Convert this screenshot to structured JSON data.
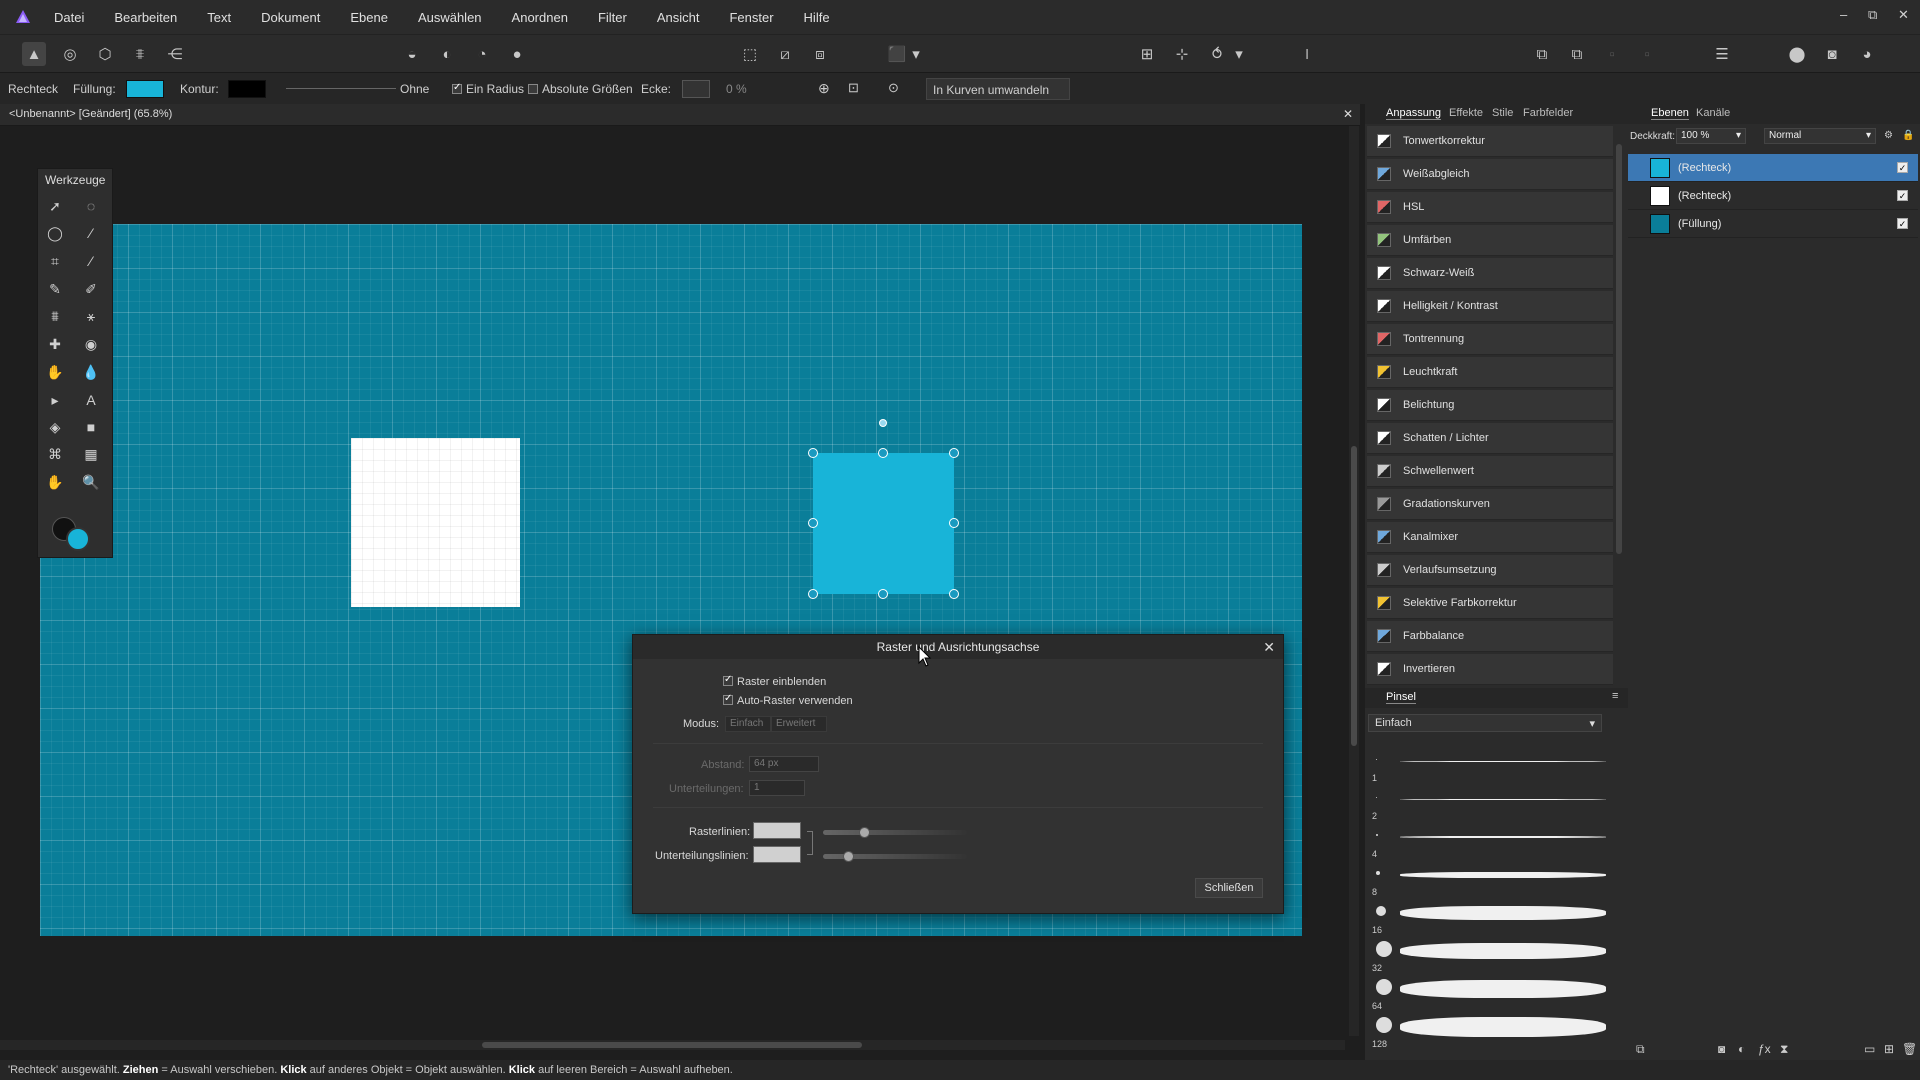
{
  "menu": [
    "Datei",
    "Bearbeiten",
    "Text",
    "Dokument",
    "Ebene",
    "Auswählen",
    "Anordnen",
    "Filter",
    "Ansicht",
    "Fenster",
    "Hilfe"
  ],
  "window_controls": {
    "minimize": "–",
    "restore": "⧉",
    "close": "✕"
  },
  "context": {
    "tool_name": "Rechteck",
    "fill_label": "Füllung:",
    "fill_color": "#18b4d8",
    "stroke_label": "Kontur:",
    "stroke_color": "#000000",
    "stroke_style": "Ohne",
    "one_radius": "Ein Radius",
    "absolute_sizes": "Absolute Größen",
    "corner_label": "Ecke:",
    "corner_value": "0 %",
    "convert_curves": "In Kurven umwandeln"
  },
  "document": {
    "tab_title": "<Unbenannt> [Geändert] (65.8%)",
    "close": "✕"
  },
  "tools_panel": {
    "title": "Werkzeuge"
  },
  "dialog": {
    "title": "Raster und Ausrichtungsachse",
    "show_grid": "Raster einblenden",
    "auto_grid": "Auto-Raster verwenden",
    "mode_label": "Modus:",
    "mode_simple": "Einfach",
    "mode_advanced": "Erweitert",
    "spacing_label": "Abstand:",
    "spacing_value": "64 px",
    "subdivisions_label": "Unterteilungen:",
    "subdivisions_value": "1",
    "gridlines_label": "Rasterlinien:",
    "subdivision_lines_label": "Unterteilungslinien:",
    "close_button": "Schließen"
  },
  "adjustments_panel": {
    "tabs": [
      "Anpassung",
      "Effekte",
      "Stile",
      "Farbfelder"
    ],
    "items": [
      "Tonwertkorrektur",
      "Weißabgleich",
      "HSL",
      "Umfärben",
      "Schwarz-Weiß",
      "Helligkeit / Kontrast",
      "Tontrennung",
      "Leuchtkraft",
      "Belichtung",
      "Schatten / Lichter",
      "Schwellenwert",
      "Gradationskurven",
      "Kanalmixer",
      "Verlaufsumsetzung",
      "Selektive Farbkorrektur",
      "Farbbalance",
      "Invertieren"
    ]
  },
  "brush_panel": {
    "tab": "Pinsel",
    "category": "Einfach",
    "sizes": [
      "1",
      "2",
      "4",
      "8",
      "16",
      "32",
      "64",
      "128"
    ]
  },
  "layers_panel": {
    "tabs": [
      "Ebenen",
      "Kanäle"
    ],
    "opacity_label": "Deckkraft:",
    "opacity_value": "100 %",
    "blend_mode": "Normal",
    "layers": [
      {
        "name": "(Rechteck)",
        "thumb": "#18b4d8",
        "selected": true
      },
      {
        "name": "(Rechteck)",
        "thumb": "#ffffff",
        "selected": false
      },
      {
        "name": "(Füllung)",
        "thumb": "#0a7e99",
        "selected": false
      }
    ]
  },
  "status": {
    "part1": "'Rechteck' ausgewählt. ",
    "b1": "Ziehen",
    "part2": " = Auswahl verschieben. ",
    "b2": "Klick",
    "part3": " auf anderes Objekt = Objekt auswählen. ",
    "b3": "Klick",
    "part4": " auf leeren Bereich = Auswahl aufheben."
  },
  "colors": {
    "accent": "#18b4d8",
    "artboard": "#0a7e99",
    "selection": "#3c78b4"
  }
}
